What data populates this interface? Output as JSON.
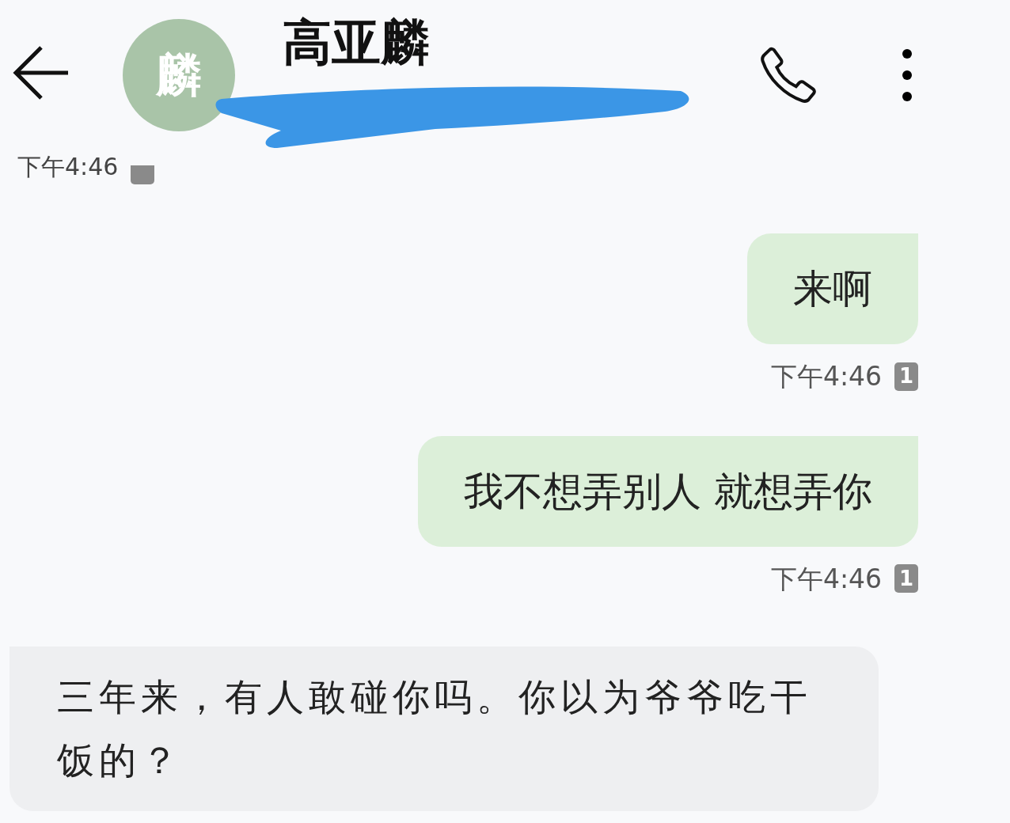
{
  "header": {
    "avatar_text": "麟",
    "contact_name": "高亚麟"
  },
  "previous_timestamp": {
    "time": "下午4:46"
  },
  "messages": [
    {
      "kind": "outgoing",
      "text": "来啊",
      "time": "下午4:46",
      "sim": "1"
    },
    {
      "kind": "outgoing",
      "text": "我不想弄别人 就想弄你",
      "time": "下午4:46",
      "sim": "1"
    },
    {
      "kind": "incoming",
      "text": "三年来，有人敢碰你吗。你以为爷爷吃干饭的？"
    }
  ]
}
